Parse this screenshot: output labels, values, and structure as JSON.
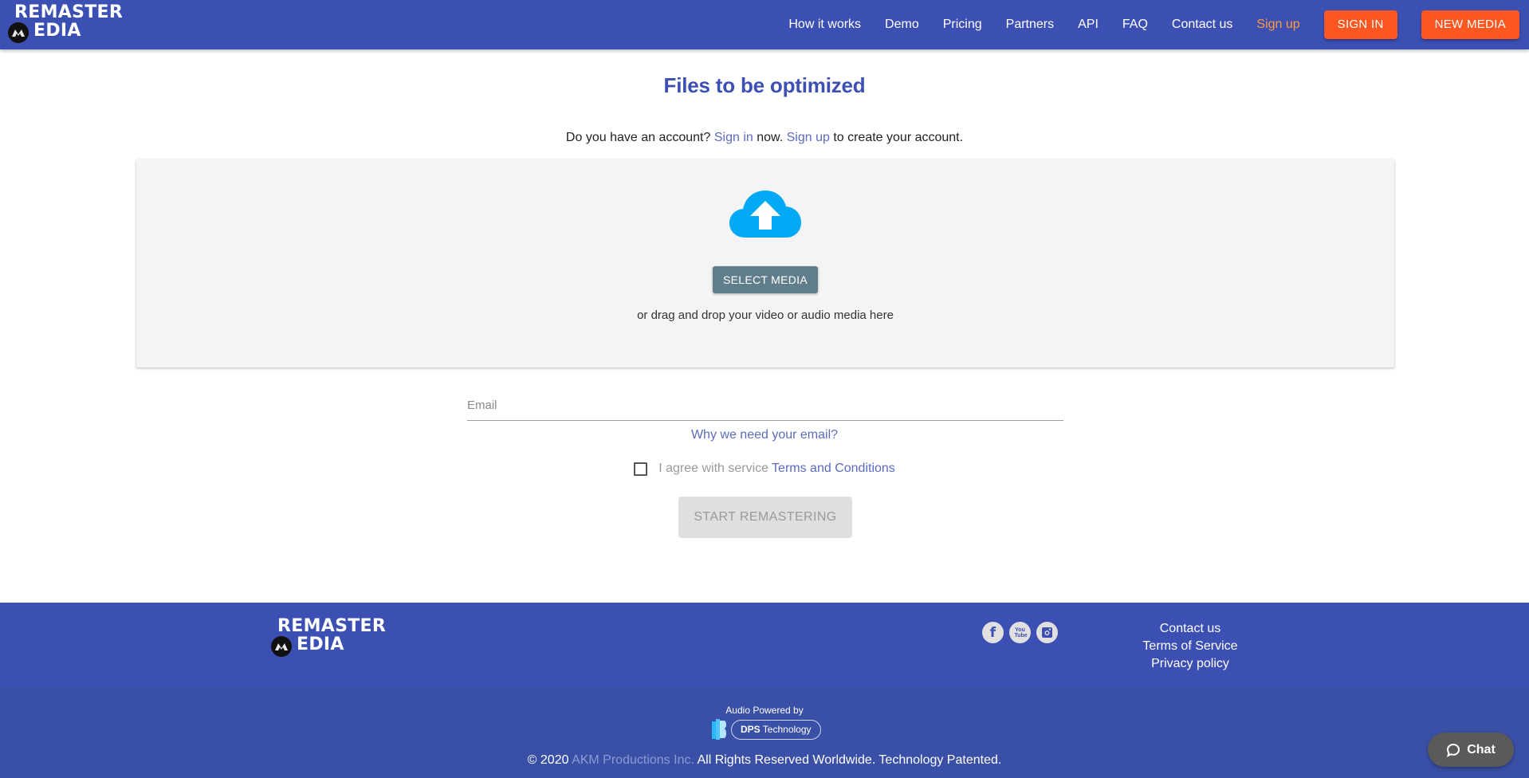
{
  "header": {
    "logo": {
      "line1": "REMASTER",
      "line2": "EDIA"
    },
    "nav": [
      {
        "label": "How it works"
      },
      {
        "label": "Demo"
      },
      {
        "label": "Pricing"
      },
      {
        "label": "Partners"
      },
      {
        "label": "API"
      },
      {
        "label": "FAQ"
      },
      {
        "label": "Contact us"
      },
      {
        "label": "Sign up"
      }
    ],
    "sign_in_label": "SIGN IN",
    "new_media_label": "NEW MEDIA"
  },
  "main": {
    "title": "Files to be optimized",
    "account": {
      "prefix": "Do you have an account?",
      "sign_in": "Sign in",
      "middle": "now.",
      "sign_up": "Sign up",
      "suffix": "to create your account."
    },
    "dropzone": {
      "icon": "cloud-upload-icon",
      "select_label": "SELECT MEDIA",
      "drag_text": "or drag and drop your video or audio media here"
    },
    "email": {
      "placeholder": "Email",
      "value": ""
    },
    "why_link": "Why we need your email?",
    "agree": {
      "text": "I agree with service",
      "link": "Terms and Conditions",
      "checked": false
    },
    "start_label": "START REMASTERING"
  },
  "footer": {
    "logo": {
      "line1": "REMASTER",
      "line2": "EDIA"
    },
    "social": [
      {
        "icon": "facebook-icon",
        "glyph": "f"
      },
      {
        "icon": "youtube-icon",
        "glyph": "You Tube"
      },
      {
        "icon": "instagram-icon",
        "glyph": ""
      }
    ],
    "links": [
      {
        "label": "Contact us"
      },
      {
        "label": "Terms of Service"
      },
      {
        "label": "Privacy policy"
      }
    ],
    "powered_by": "Audio Powered by",
    "dps": {
      "bold": "DPS",
      "rest": " Technology"
    },
    "copyright": {
      "prefix": "© 2020",
      "company": "AKM Productions Inc.",
      "suffix": "All Rights Reserved Worldwide. Technology Patented."
    }
  },
  "chat": {
    "label": "Chat"
  },
  "colors": {
    "brand_blue": "#3c50b4",
    "accent_orange": "#ff5722",
    "signup_orange": "#ff9a3c",
    "link_blue": "#5c6bc0",
    "cloud_blue": "#03a9f4",
    "select_button": "#607d8b"
  }
}
